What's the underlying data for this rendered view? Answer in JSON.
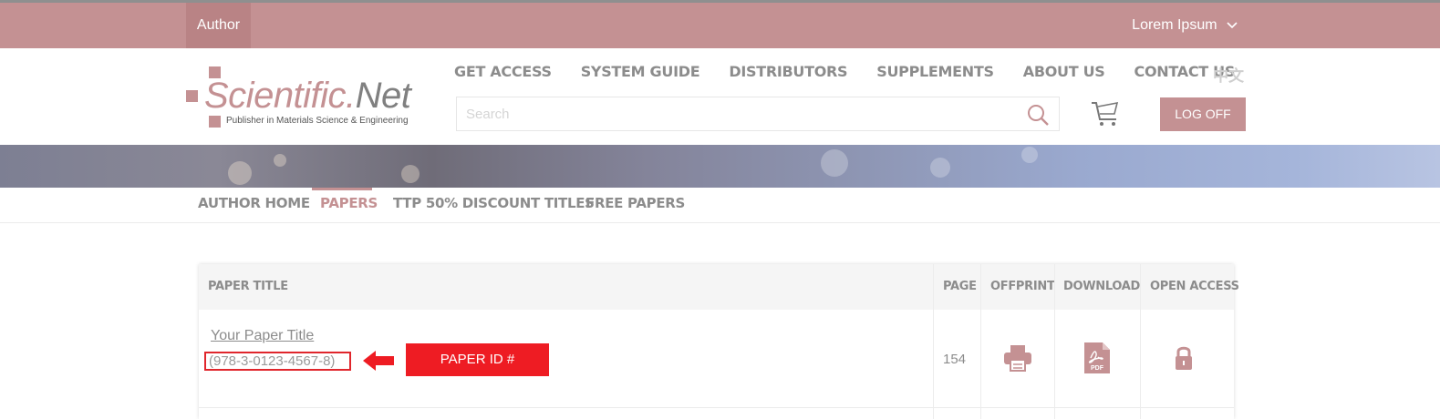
{
  "topbar": {
    "author_tab": "Author",
    "user_name": "Lorem Ipsum"
  },
  "logo": {
    "brand_main": "Scientific.",
    "brand_net": "Net",
    "tagline": "Publisher in Materials Science & Engineering"
  },
  "main_nav": {
    "items": [
      "GET ACCESS",
      "SYSTEM GUIDE",
      "DISTRIBUTORS",
      "SUPPLEMENTS",
      "ABOUT US",
      "CONTACT US"
    ],
    "language": "中文"
  },
  "search": {
    "placeholder": "Search"
  },
  "header_actions": {
    "logoff_label": "LOG OFF"
  },
  "sub_nav": {
    "items": [
      "AUTHOR HOME",
      "PAPERS",
      "TTP 50% DISCOUNT TITLES",
      "FREE PAPERS"
    ],
    "active": "PAPERS"
  },
  "table": {
    "headers": {
      "title": "PAPER TITLE",
      "page": "PAGE",
      "offprint": "OFFPRINT",
      "download": "DOWNLOAD",
      "open_access": "OPEN ACCESS"
    },
    "rows": [
      {
        "title": "Your Paper Title",
        "id": "(978-3-0123-4567-8)",
        "page": "154"
      }
    ],
    "annotation_label": "PAPER ID #"
  },
  "colors": {
    "brand": "#c49193",
    "highlight_red": "#ee1c23",
    "text_gray": "#8c8c8c"
  },
  "icons": [
    "search-icon",
    "cart-icon",
    "chevron-down-icon",
    "printer-icon",
    "pdf-icon",
    "lock-icon",
    "arrow-left-icon"
  ]
}
